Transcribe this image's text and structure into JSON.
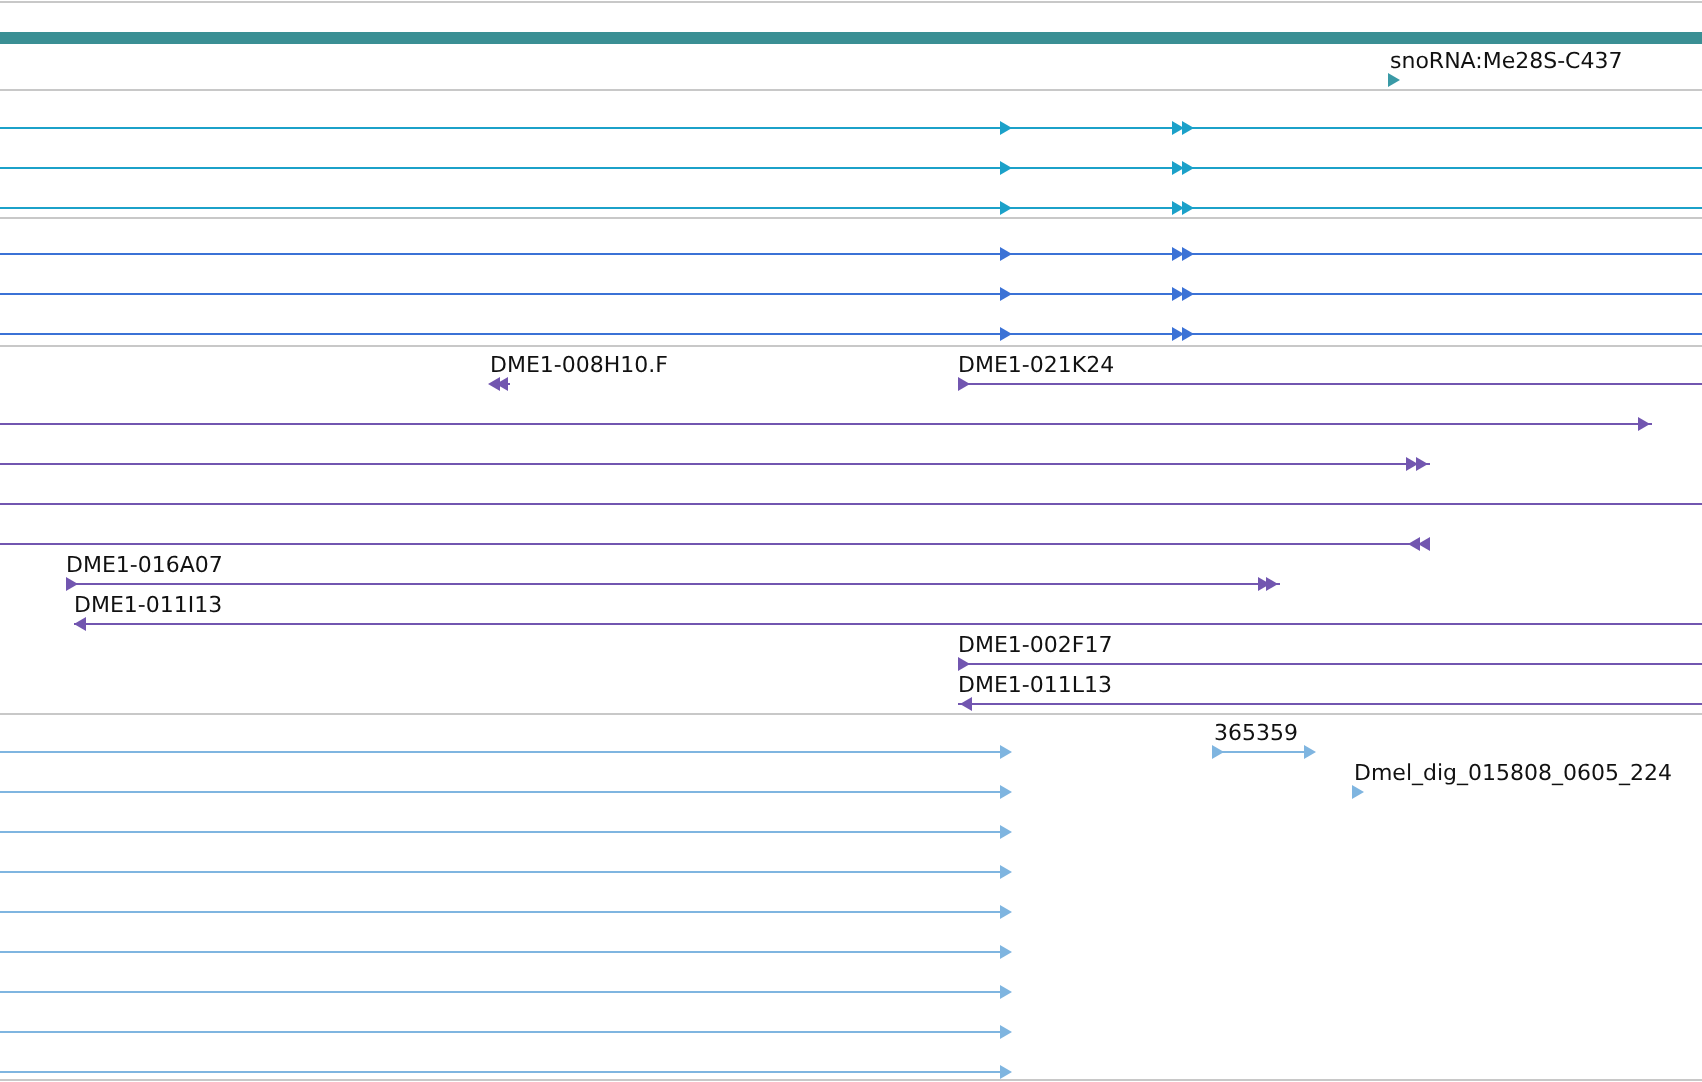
{
  "tracks": [
    {
      "color": "#3a9aa6",
      "rows": [
        [
          {
            "label": "snoRNA:Me28S-C437",
            "reverse": false
          }
        ]
      ]
    },
    {
      "color": "#1ba1c9",
      "rows": [
        [
          {
            "reverse": false
          }
        ],
        [
          {
            "reverse": false
          }
        ],
        [
          {
            "reverse": false
          }
        ]
      ]
    },
    {
      "color": "#3b72d6",
      "rows": [
        [
          {
            "reverse": false
          }
        ],
        [
          {
            "reverse": false
          }
        ],
        [
          {
            "reverse": false
          }
        ]
      ]
    },
    {
      "color": "#7256b0",
      "rows": [
        [
          {
            "label": "DME1-008H10.F",
            "reverse": true
          },
          {
            "label": "DME1-021K24",
            "reverse": false
          }
        ],
        [
          {
            "reverse": false
          }
        ],
        [
          {
            "reverse": false
          }
        ],
        [
          {}
        ],
        [
          {
            "reverse": true
          }
        ],
        [
          {
            "label": "DME1-016A07",
            "reverse": false
          }
        ],
        [
          {
            "label": "DME1-011I13",
            "reverse": true
          }
        ],
        [
          {
            "label": "DME1-002F17",
            "reverse": false
          }
        ],
        [
          {
            "label": "DME1-011L13",
            "reverse": true
          }
        ]
      ]
    },
    {
      "color": "#7fb5e0",
      "rows": [
        [
          {
            "reverse": false
          },
          {
            "label": "365359",
            "reverse": false
          }
        ],
        [
          {
            "reverse": false
          },
          {
            "label": "Dmel_dig_015808_0605_224",
            "reverse": false
          }
        ],
        [
          {
            "reverse": false
          }
        ],
        [
          {
            "reverse": false
          }
        ],
        [
          {
            "reverse": false
          }
        ],
        [
          {
            "reverse": false
          }
        ],
        [
          {
            "reverse": false
          }
        ],
        [
          {
            "reverse": false
          }
        ],
        [
          {
            "reverse": false
          }
        ]
      ]
    }
  ]
}
